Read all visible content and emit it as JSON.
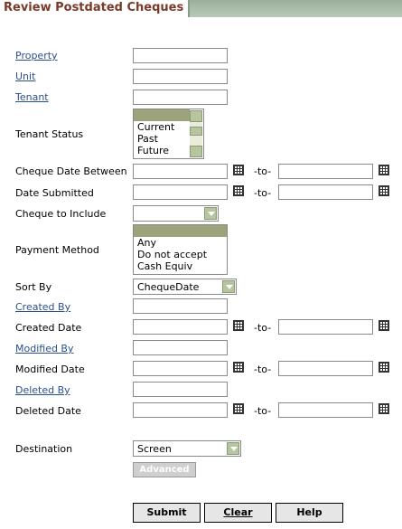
{
  "tab": {
    "title": "Review Postdated Cheques"
  },
  "labels": {
    "property": "Property",
    "unit": "Unit",
    "tenant": "Tenant",
    "tenant_status": "Tenant Status",
    "cheque_date_between": "Cheque Date Between",
    "date_submitted": "Date Submitted",
    "cheque_to_include": "Cheque to Include",
    "payment_method": "Payment Method",
    "sort_by": "Sort By",
    "created_by": "Created By",
    "created_date": "Created Date",
    "modified_by": "Modified By",
    "modified_date": "Modified Date",
    "deleted_by": "Deleted By",
    "deleted_date": "Deleted Date",
    "destination": "Destination"
  },
  "to_text": "-to-",
  "tenant_status_options": [
    "Current",
    "Past",
    "Future"
  ],
  "payment_method_options": [
    "Any",
    "Do not accept",
    "Cash Equiv"
  ],
  "sort_by_value": "ChequeDate",
  "destination_value": "Screen",
  "buttons": {
    "advanced": "Advanced",
    "submit": "Submit",
    "clear": "Clear",
    "help": "Help"
  }
}
